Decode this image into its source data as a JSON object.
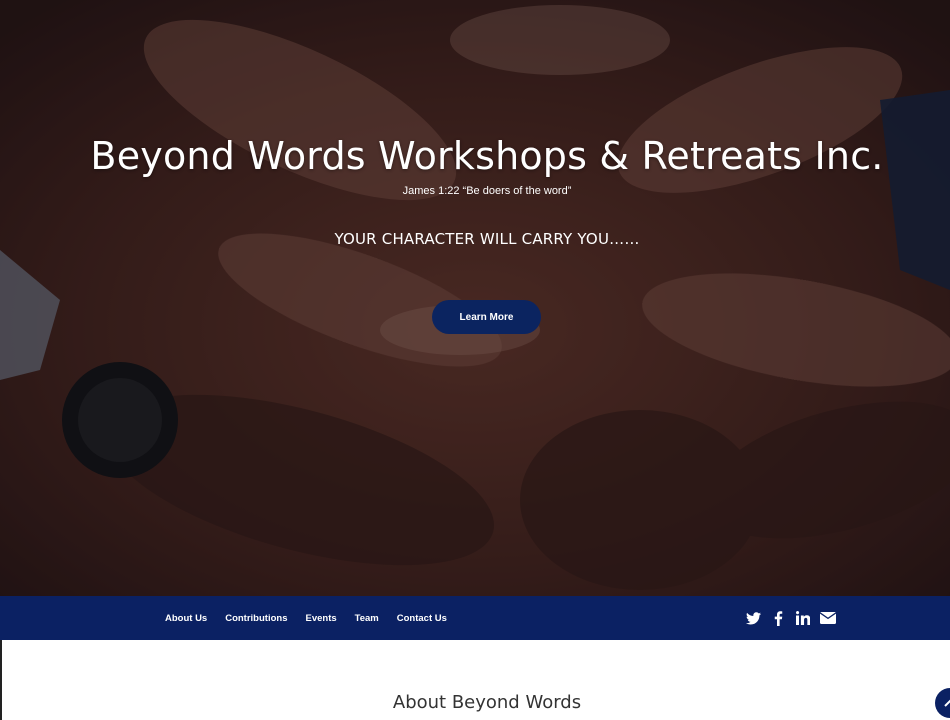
{
  "hero": {
    "title": "Beyond Words Workshops & Retreats Inc.",
    "verse": "James 1:22 “Be doers of the word”",
    "tagline": "YOUR CHARACTER WILL CARRY YOU……",
    "button_label": "Learn More"
  },
  "nav": {
    "items": [
      {
        "label": "About Us"
      },
      {
        "label": "Contributions"
      },
      {
        "label": "Events"
      },
      {
        "label": "Team"
      },
      {
        "label": "Contact Us"
      }
    ],
    "social": [
      "twitter-icon",
      "facebook-icon",
      "linkedin-icon",
      "envelope-icon"
    ]
  },
  "main": {
    "section_title": "About Beyond Words"
  },
  "colors": {
    "nav_bg": "#0b2163",
    "button_bg": "#0b2460",
    "hero_overlay": "#2a1612"
  }
}
